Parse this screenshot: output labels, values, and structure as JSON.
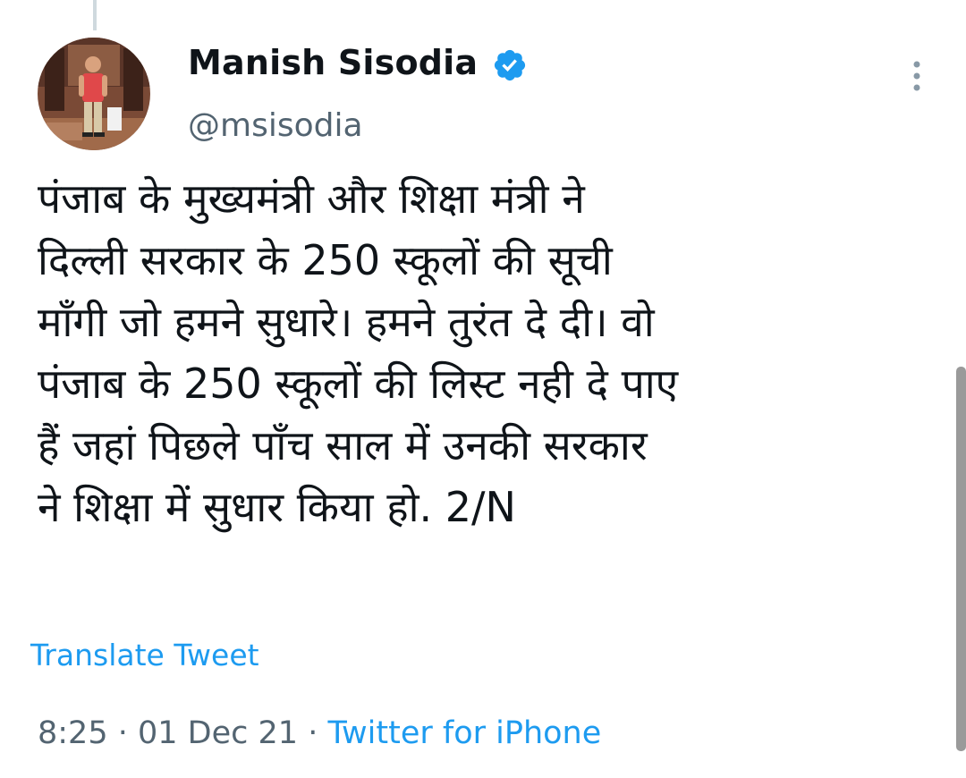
{
  "author": {
    "display_name": "Manish Sisodia",
    "handle": "@msisodia",
    "verified": true,
    "avatar_icon": "profile-photo"
  },
  "tweet": {
    "lines": [
      "पंजाब के मुख्यमंत्री और शिक्षा मंत्री ने",
      "दिल्ली सरकार के 250 स्कूलों की सूची",
      "माँगी जो हमने सुधारे। हमने तुरंत दे दी। वो",
      "पंजाब के 250 स्कूलों की लिस्ट नही दे पाए",
      "हैं जहां पिछले पाँच साल में उनकी सरकार",
      "ने शिक्षा में सुधार किया हो. 2/N"
    ]
  },
  "translate_label": "Translate Tweet",
  "meta": {
    "time": "8:25",
    "separator": " · ",
    "date": "01 Dec 21",
    "source": "Twitter for iPhone"
  },
  "colors": {
    "accent": "#1d9bf0",
    "text": "#0f1419",
    "secondary": "#536471"
  },
  "icons": {
    "verified": "verified-badge-icon",
    "more": "more-options-icon"
  }
}
